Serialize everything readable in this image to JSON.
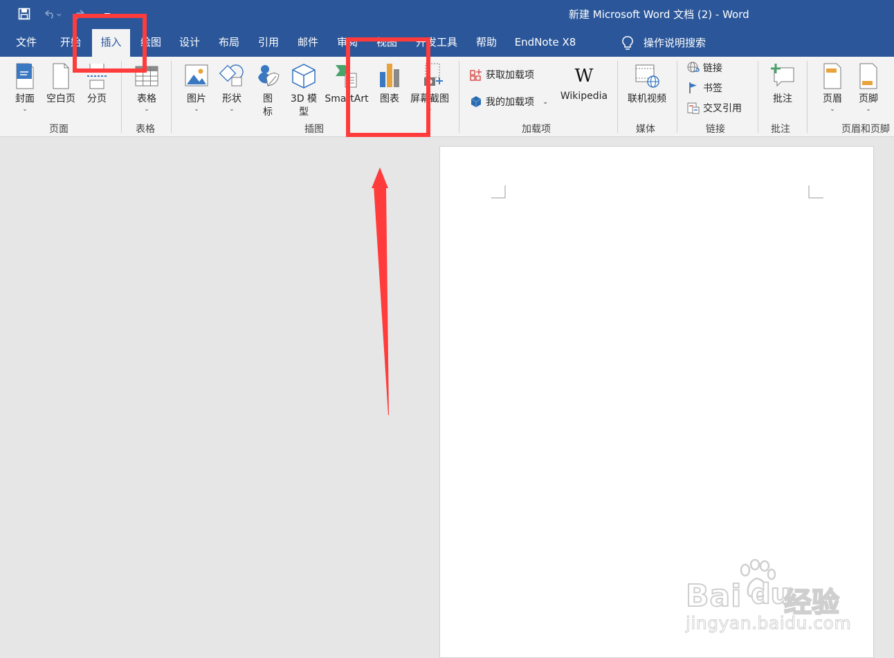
{
  "window": {
    "title": "新建 Microsoft Word 文档 (2)  -  Word"
  },
  "quick_access": {
    "icons": [
      "save-icon",
      "undo-icon",
      "redo-icon",
      "customize-icon"
    ]
  },
  "tabs": [
    {
      "label": "文件"
    },
    {
      "label": "开始"
    },
    {
      "label": "插入",
      "active": true
    },
    {
      "label": "绘图"
    },
    {
      "label": "设计"
    },
    {
      "label": "布局"
    },
    {
      "label": "引用"
    },
    {
      "label": "邮件"
    },
    {
      "label": "审阅"
    },
    {
      "label": "视图"
    },
    {
      "label": "开发工具"
    },
    {
      "label": "帮助"
    },
    {
      "label": "EndNote X8"
    }
  ],
  "tell_me": {
    "label": "操作说明搜索"
  },
  "ribbon": {
    "pages_group": {
      "label": "页面",
      "buttons": [
        {
          "label": "封面"
        },
        {
          "label": "空白页"
        },
        {
          "label": "分页"
        }
      ]
    },
    "table_group": {
      "label": "表格",
      "buttons": [
        {
          "label": "表格"
        }
      ]
    },
    "illustrations_group": {
      "label": "插图",
      "buttons": [
        {
          "label": "图片"
        },
        {
          "label": "形状"
        },
        {
          "label": "图",
          "label2": "标"
        },
        {
          "label": "3D 模",
          "label2": "型"
        },
        {
          "label": "SmartArt"
        },
        {
          "label": "图表"
        },
        {
          "label": "屏幕截图"
        }
      ]
    },
    "addins_group": {
      "label": "加载项",
      "get_addins": "获取加载项",
      "my_addins": "我的加载项",
      "wikipedia": "Wikipedia"
    },
    "media_group": {
      "label": "媒体",
      "online_video": "联机视频"
    },
    "links_group": {
      "label": "链接",
      "link": "链接",
      "bookmark": "书签",
      "cross_reference": "交叉引用"
    },
    "comments_group": {
      "label": "批注",
      "comment": "批注"
    },
    "header_footer_group": {
      "label": "页眉和页脚",
      "header": "页眉",
      "footer": "页脚"
    }
  },
  "watermark": {
    "brand": "Bai",
    "brand2": "du",
    "brand_cn": "经验",
    "url": "jingyan.baidu.com"
  },
  "colors": {
    "title_bar": "#2b579a",
    "ribbon": "#f3f3f3",
    "annotation": "#ff3b3b",
    "canvas": "#e6e6e6"
  }
}
